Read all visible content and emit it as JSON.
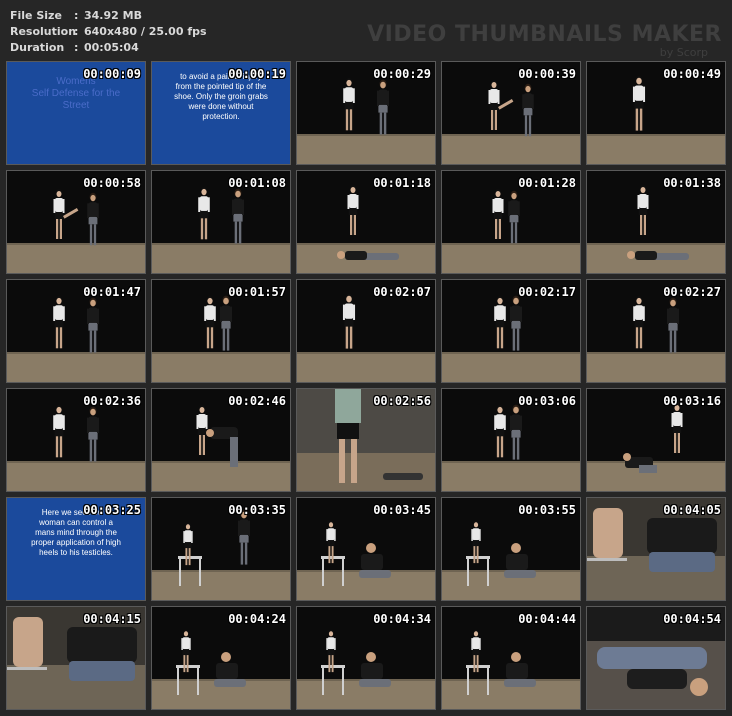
{
  "info": [
    {
      "label": "File Size",
      "value": "34.92 MB"
    },
    {
      "label": "Resolution",
      "value": "640x480 / 25.00 fps"
    },
    {
      "label": "Duration",
      "value": "00:05:04"
    }
  ],
  "brand": {
    "title": "VIDEO THUMBNAILS MAKER",
    "subtitle": "by Scorp"
  },
  "colors": {
    "background": "#262626",
    "title_card": "#1b4a9c",
    "info_text": "#d9d9d9",
    "brand_text": "#3f3f3f"
  },
  "thumbnails": [
    {
      "time": "00:00:09",
      "kind": "card",
      "title": "Womens\nSelf Defense for the\nStreet",
      "text": ""
    },
    {
      "time": "00:00:19",
      "kind": "card",
      "title": "",
      "text": "to avoid a painful injury\nfrom the pointed tip of the\nshoe. Only the groin grabs\nwere done without\nprotection."
    },
    {
      "time": "00:00:29",
      "kind": "pair-stand"
    },
    {
      "time": "00:00:39",
      "kind": "kick"
    },
    {
      "time": "00:00:49",
      "kind": "woman-stand"
    },
    {
      "time": "00:00:58",
      "kind": "kick"
    },
    {
      "time": "00:01:08",
      "kind": "pair-stand"
    },
    {
      "time": "00:01:18",
      "kind": "man-down"
    },
    {
      "time": "00:01:28",
      "kind": "grab"
    },
    {
      "time": "00:01:38",
      "kind": "man-down"
    },
    {
      "time": "00:01:47",
      "kind": "pair-stand"
    },
    {
      "time": "00:01:57",
      "kind": "pair-close"
    },
    {
      "time": "00:02:07",
      "kind": "woman-stand"
    },
    {
      "time": "00:02:17",
      "kind": "pair-close"
    },
    {
      "time": "00:02:27",
      "kind": "pair-stand"
    },
    {
      "time": "00:02:36",
      "kind": "pair-stand"
    },
    {
      "time": "00:02:46",
      "kind": "bend"
    },
    {
      "time": "00:02:56",
      "kind": "legs-close"
    },
    {
      "time": "00:03:06",
      "kind": "pair-close"
    },
    {
      "time": "00:03:16",
      "kind": "kneel-stand"
    },
    {
      "time": "00:03:25",
      "kind": "card",
      "title": "",
      "text": "Here we see how a\nwoman can control a\nmans mind through the\nproper application of high\nheels to his testicles."
    },
    {
      "time": "00:03:35",
      "kind": "chair-stand"
    },
    {
      "time": "00:03:45",
      "kind": "chair-kneel"
    },
    {
      "time": "00:03:55",
      "kind": "chair-kneel"
    },
    {
      "time": "00:04:05",
      "kind": "closeup"
    },
    {
      "time": "00:04:15",
      "kind": "closeup"
    },
    {
      "time": "00:04:24",
      "kind": "chair-kneel"
    },
    {
      "time": "00:04:34",
      "kind": "chair-kneel"
    },
    {
      "time": "00:04:44",
      "kind": "chair-kneel"
    },
    {
      "time": "00:04:54",
      "kind": "lying-close"
    }
  ]
}
